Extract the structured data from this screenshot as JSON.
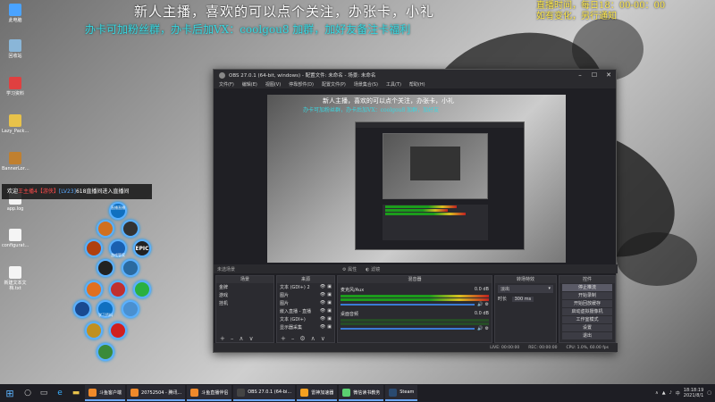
{
  "overlay": {
    "line1": "新人主播，喜欢的可以点个关注，办张卡，小礼",
    "line2": "办卡可加粉丝群，办卡后加VX：coolgou8 加群，加好友备注卡福利",
    "corner_l1": "直播时间，每日18：00-00：00",
    "corner_l2": "如有变化，另行通知"
  },
  "desktop": [
    {
      "label": "此电脑",
      "color": "#4aa3ff"
    },
    {
      "label": "回收站",
      "color": "#8ab6d8"
    },
    {
      "label": "学习资料",
      "color": "#e04040"
    },
    {
      "label": "Lazy_Pack…",
      "color": "#e8c24a"
    },
    {
      "label": "BannerLor…",
      "color": "#c08030"
    },
    {
      "label": "app.log",
      "color": "#f4f4f4"
    },
    {
      "label": "configurat…",
      "color": "#f4f4f4"
    },
    {
      "label": "新建文本文档.txt",
      "color": "#f4f4f4"
    }
  ],
  "toast": {
    "prefix": "欢迎",
    "user": "王主播4",
    "tag": "【游侠】",
    "level": "[LV23]",
    "suffix": "618直播间进入直播间"
  },
  "hex_menu": {
    "top": "直播直播",
    "center": "游戏管家",
    "epic": "EPIC",
    "study": "学习资料"
  },
  "obs": {
    "title": "OBS 27.0.1 (64-bit, windows) - 配置文件: 未命名 - 场景: 未命名",
    "menu": [
      "文件(F)",
      "编辑(E)",
      "视图(V)",
      "停靠部件(D)",
      "配置文件(P)",
      "场景集合(S)",
      "工具(T)",
      "帮助(H)"
    ],
    "preview_line1": "新人主播，喜欢的可以点个关注，办张卡，小礼",
    "preview_line2": "办卡可加粉丝群，办卡后加VX：coolgou8 加群，加好友",
    "scene_label": "未选场景",
    "attr_btn": "属性",
    "filter_btn": "滤镜",
    "docks": {
      "scenes": {
        "title": "场景",
        "items": [
          "金牌",
          "游戏",
          "挂机"
        ]
      },
      "sources": {
        "title": "来源",
        "items": [
          "文本 (GDI+) 2",
          "图片",
          "图片",
          "嵌入直播 - 直播",
          "文本 (GDI+)",
          "显示器采集"
        ]
      },
      "mixer": {
        "title": "混音器",
        "tracks": [
          {
            "name": "麦克风/Aux",
            "db": "0.0 dB"
          },
          {
            "name": "桌面音频",
            "db": "0.0 dB"
          }
        ]
      },
      "transitions": {
        "title": "转场特效",
        "type": "淡出",
        "duration_label": "时长",
        "duration": "300 ms"
      },
      "controls": {
        "title": "控件",
        "buttons": [
          "停止推流",
          "开始录制",
          "开始回放缓存",
          "启动虚拟摄像机",
          "工作室模式",
          "设置",
          "退出"
        ]
      }
    },
    "status": {
      "live": "LIVE: 00:00:00",
      "rec": "REC: 00:00:00",
      "cpu": "CPU: 1.0%, 60.00 fps"
    }
  },
  "taskbar": {
    "apps": [
      {
        "label": "斗鱼客户端",
        "color": "#f08a2a"
      },
      {
        "label": "20752504 - 腾讯...",
        "color": "#f08a2a"
      },
      {
        "label": "斗鱼直播伴侣",
        "color": "#f08a2a"
      },
      {
        "label": "OBS 27.0.1 (64-bi...",
        "color": "#444"
      },
      {
        "label": "雷神加速器",
        "color": "#f4a020"
      },
      {
        "label": "微信读书教务",
        "color": "#5ad070"
      },
      {
        "label": "Steam",
        "color": "#2a4a70"
      }
    ],
    "time": "18:18:19",
    "date": "2021/8/1",
    "lang": "中"
  }
}
